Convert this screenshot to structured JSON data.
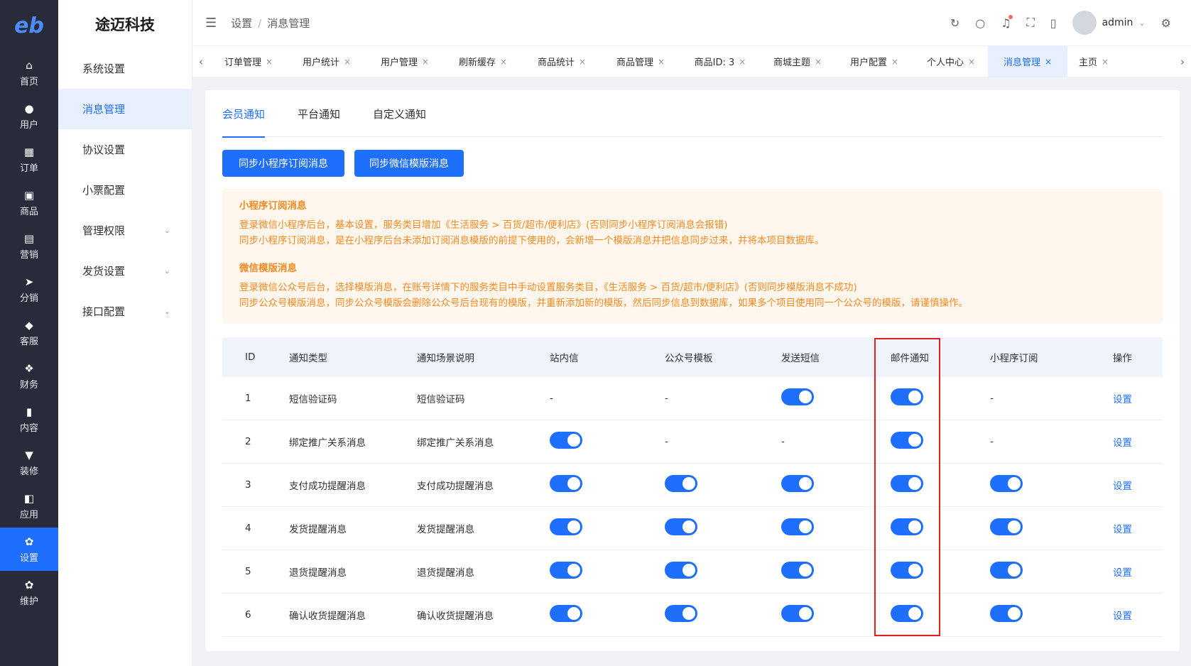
{
  "nav": {
    "logo": "eb",
    "items": [
      {
        "label": "首页",
        "icon": "home-icon",
        "glyph": "⌂"
      },
      {
        "label": "用户",
        "icon": "user-icon",
        "glyph": "●"
      },
      {
        "label": "订单",
        "icon": "order-icon",
        "glyph": "▦"
      },
      {
        "label": "商品",
        "icon": "product-icon",
        "glyph": "▣"
      },
      {
        "label": "营销",
        "icon": "marketing-icon",
        "glyph": "▤"
      },
      {
        "label": "分销",
        "icon": "distribution-icon",
        "glyph": "➤"
      },
      {
        "label": "客服",
        "icon": "service-icon",
        "glyph": "◆"
      },
      {
        "label": "财务",
        "icon": "finance-icon",
        "glyph": "❖"
      },
      {
        "label": "内容",
        "icon": "content-icon",
        "glyph": "▮"
      },
      {
        "label": "装修",
        "icon": "decoration-icon",
        "glyph": "▼"
      },
      {
        "label": "应用",
        "icon": "app-icon",
        "glyph": "◧"
      },
      {
        "label": "设置",
        "icon": "settings-icon",
        "glyph": "✿"
      },
      {
        "label": "维护",
        "icon": "maintain-icon",
        "glyph": "✿"
      }
    ]
  },
  "submenu": {
    "brand": "途迈科技",
    "items": [
      {
        "label": "系统设置",
        "chevron": false
      },
      {
        "label": "消息管理",
        "chevron": false
      },
      {
        "label": "协议设置",
        "chevron": false
      },
      {
        "label": "小票配置",
        "chevron": false
      },
      {
        "label": "管理权限",
        "chevron": true
      },
      {
        "label": "发货设置",
        "chevron": true
      },
      {
        "label": "接口配置",
        "chevron": true
      }
    ]
  },
  "header": {
    "breadcrumb": [
      "设置",
      "消息管理"
    ],
    "user": "admin"
  },
  "tabs": [
    {
      "label": "订单管理",
      "w": 110
    },
    {
      "label": "用户统计",
      "w": 110
    },
    {
      "label": "用户管理",
      "w": 110
    },
    {
      "label": "刷新缓存",
      "w": 110
    },
    {
      "label": "商品统计",
      "w": 112
    },
    {
      "label": "商品管理",
      "w": 110
    },
    {
      "label": "商品ID: 3",
      "w": 114
    },
    {
      "label": "商城主题",
      "w": 104
    },
    {
      "label": "用户配置",
      "w": 112
    },
    {
      "label": "个人中心",
      "w": 104
    },
    {
      "label": "消息管理",
      "w": 112
    },
    {
      "label": "主页",
      "w": 74
    }
  ],
  "notice_tabs": [
    "会员通知",
    "平台通知",
    "自定义通知"
  ],
  "buttons": {
    "sync_mini": "同步小程序订阅消息",
    "sync_wechat": "同步微信模版消息"
  },
  "notice": {
    "mini_title": "小程序订阅消息",
    "mini_line1": "登录微信小程序后台，基本设置，服务类目增加《生活服务 > 百货/超市/便利店》(否则同步小程序订阅消息会报错)",
    "mini_line2": "同步小程序订阅消息，是在小程序后台未添加订阅消息模版的前提下使用的，会新增一个模版消息并把信息同步过来，并将本项目数据库。",
    "wx_title": "微信模版消息",
    "wx_line1": "登录微信公众号后台，选择模版消息，在账号详情下的服务类目中手动设置服务类目，《生活服务 > 百货/超市/便利店》(否则同步模版消息不成功)",
    "wx_line2": "同步公众号模版消息，同步公众号模版会删除公众号后台现有的模版，并重新添加新的模版，然后同步信息到数据库，如果多个项目使用同一个公众号的模版，请谨慎操作。"
  },
  "table": {
    "headers": [
      "ID",
      "通知类型",
      "通知场景说明",
      "站内信",
      "公众号模板",
      "发送短信",
      "邮件通知",
      "小程序订阅",
      "操作"
    ],
    "rows": [
      {
        "id": "1",
        "type": "短信验证码",
        "desc": "短信验证码",
        "site": null,
        "wechat": null,
        "sms": true,
        "email": true,
        "mini": null,
        "action": "设置"
      },
      {
        "id": "2",
        "type": "绑定推广关系消息",
        "desc": "绑定推广关系消息",
        "site": true,
        "wechat": null,
        "sms": null,
        "email": true,
        "mini": null,
        "action": "设置"
      },
      {
        "id": "3",
        "type": "支付成功提醒消息",
        "desc": "支付成功提醒消息",
        "site": true,
        "wechat": true,
        "sms": true,
        "email": true,
        "mini": true,
        "action": "设置"
      },
      {
        "id": "4",
        "type": "发货提醒消息",
        "desc": "发货提醒消息",
        "site": true,
        "wechat": true,
        "sms": true,
        "email": true,
        "mini": true,
        "action": "设置"
      },
      {
        "id": "5",
        "type": "退货提醒消息",
        "desc": "退货提醒消息",
        "site": true,
        "wechat": true,
        "sms": true,
        "email": true,
        "mini": true,
        "action": "设置"
      },
      {
        "id": "6",
        "type": "确认收货提醒消息",
        "desc": "确认收货提醒消息",
        "site": true,
        "wechat": true,
        "sms": true,
        "email": true,
        "mini": true,
        "action": "设置"
      }
    ],
    "empty": "-"
  },
  "colors": {
    "primary": "#1f6fff",
    "nav_bg": "#282c3a",
    "notice": "#f08a24",
    "highlight": "#e02020"
  }
}
